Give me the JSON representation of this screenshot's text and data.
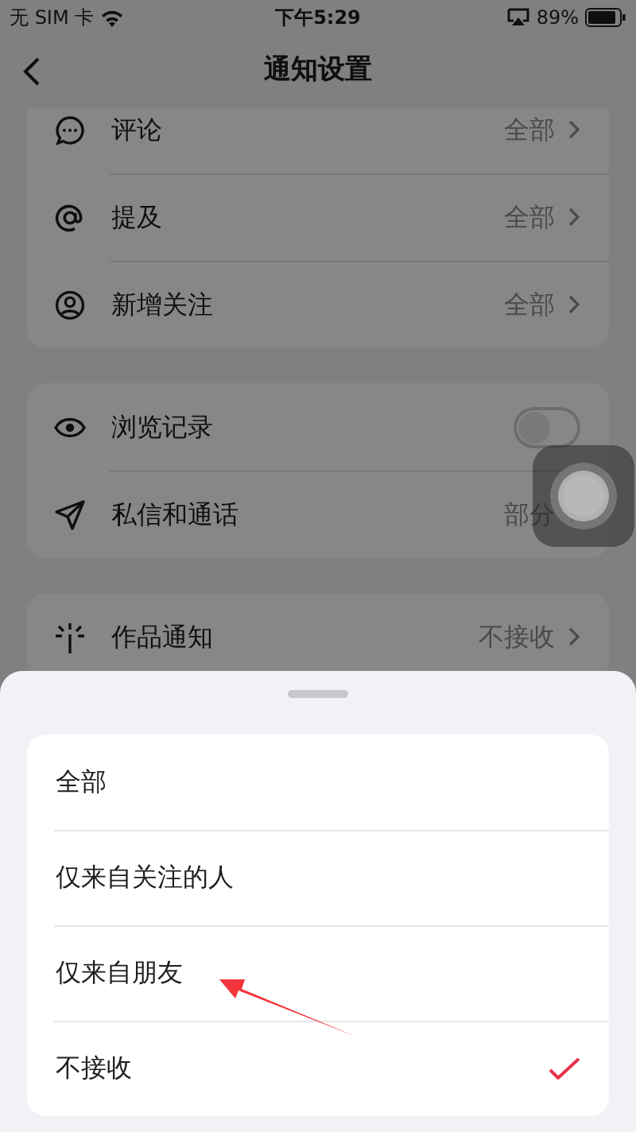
{
  "status_bar": {
    "carrier": "无 SIM 卡",
    "time": "下午5:29",
    "battery": "89%"
  },
  "nav": {
    "title": "通知设置"
  },
  "groups": [
    {
      "items": [
        {
          "kind": "link",
          "label": "评论",
          "value": "全部"
        },
        {
          "kind": "link",
          "label": "提及",
          "value": "全部"
        },
        {
          "kind": "link",
          "label": "新增关注",
          "value": "全部"
        }
      ]
    },
    {
      "items": [
        {
          "kind": "toggle",
          "label": "浏览记录",
          "on": false
        },
        {
          "kind": "link",
          "label": "私信和通话",
          "value": "部分"
        }
      ]
    },
    {
      "items": [
        {
          "kind": "link",
          "label": "作品通知",
          "value": "不接收"
        }
      ]
    }
  ],
  "sheet": {
    "options": [
      {
        "label": "全部",
        "selected": false
      },
      {
        "label": "仅来自关注的人",
        "selected": false
      },
      {
        "label": "仅来自朋友",
        "selected": false
      },
      {
        "label": "不接收",
        "selected": true
      }
    ]
  }
}
